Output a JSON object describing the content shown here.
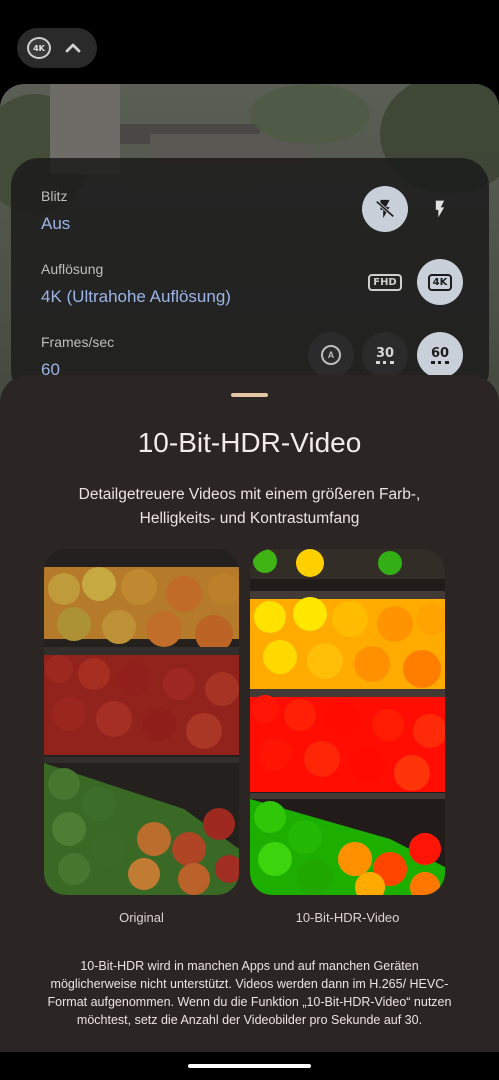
{
  "top_chip": {
    "badge_text": "4K"
  },
  "settings": {
    "flash": {
      "label": "Blitz",
      "value": "Aus"
    },
    "resolution": {
      "label": "Auflösung",
      "value": "4K (Ultrahohe Auflösung)",
      "option_fhd": "FHD",
      "option_4k": "4K"
    },
    "fps": {
      "label": "Frames/sec",
      "value": "60",
      "option_auto": "A",
      "option_30": "30",
      "option_60": "60"
    }
  },
  "sheet": {
    "title": "10-Bit-HDR-Video",
    "subtitle": "Detailgetreuere Videos mit einem größeren Farb-, Helligkeits- und Kontrastumfang",
    "caption_original": "Original",
    "caption_hdr": "10-Bit-HDR-Video",
    "note": "10-Bit-HDR wird in manchen Apps und auf manchen Geräten möglicherweise nicht unterstützt. Videos werden dann im H.265/ HEVC-Format aufgenommen. Wenn du die Funktion „10-Bit-HDR-Video“ nutzen möchtest, setz die Anzahl der Videobilder pro Sekunde auf 30."
  },
  "colors": {
    "accent_value": "#9db4e6",
    "sheet_bg": "#2b2523",
    "handle": "#e3c6a4",
    "selected_button": "#c9d0da"
  },
  "icons": [
    "4k-icon",
    "chevron-up-icon",
    "flash-off-icon",
    "flash-on-icon",
    "fhd-icon",
    "4k-icon",
    "fps-auto-icon",
    "fps-30-icon",
    "fps-60-icon"
  ]
}
